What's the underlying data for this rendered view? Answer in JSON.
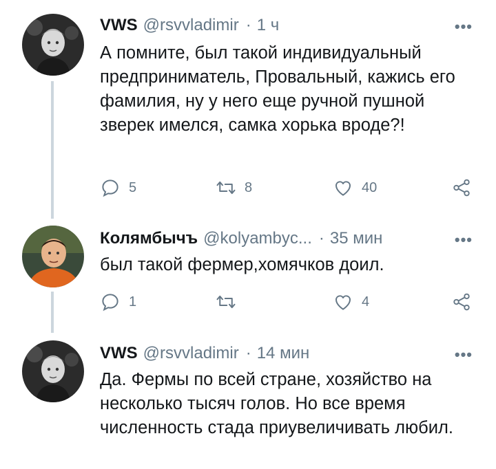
{
  "tweets": [
    {
      "name": "VWS",
      "handle": "@rsvvladimir",
      "separator": "·",
      "time": "1 ч",
      "more": "•••",
      "text": "А помните, был такой индивидуальный предприниматель, Провальный, кажись его фамилия, ну у него еще ручной пушной зверек имелся, самка хорька вроде?!",
      "replies": "5",
      "retweets": "8",
      "likes": "40"
    },
    {
      "name": "Колямбычъ",
      "handle": "@kolyambyc...",
      "separator": "·",
      "time": "35 мин",
      "more": "•••",
      "text": "был такой фермер,хомячков доил.",
      "replies": "1",
      "retweets": "",
      "likes": "4"
    },
    {
      "name": "VWS",
      "handle": "@rsvvladimir",
      "separator": "·",
      "time": "14 мин",
      "more": "•••",
      "text": "Да. Фермы по всей стране, хозяйство на несколько тысяч голов. Но все время численность стада приувеличивать любил."
    }
  ],
  "icons": {
    "reply": "reply-icon",
    "retweet": "retweet-icon",
    "like": "like-icon",
    "share": "share-icon",
    "more": "more-icon"
  },
  "colors": {
    "text": "#14171a",
    "secondary": "#657786",
    "thread_line": "#ccd6dd"
  }
}
